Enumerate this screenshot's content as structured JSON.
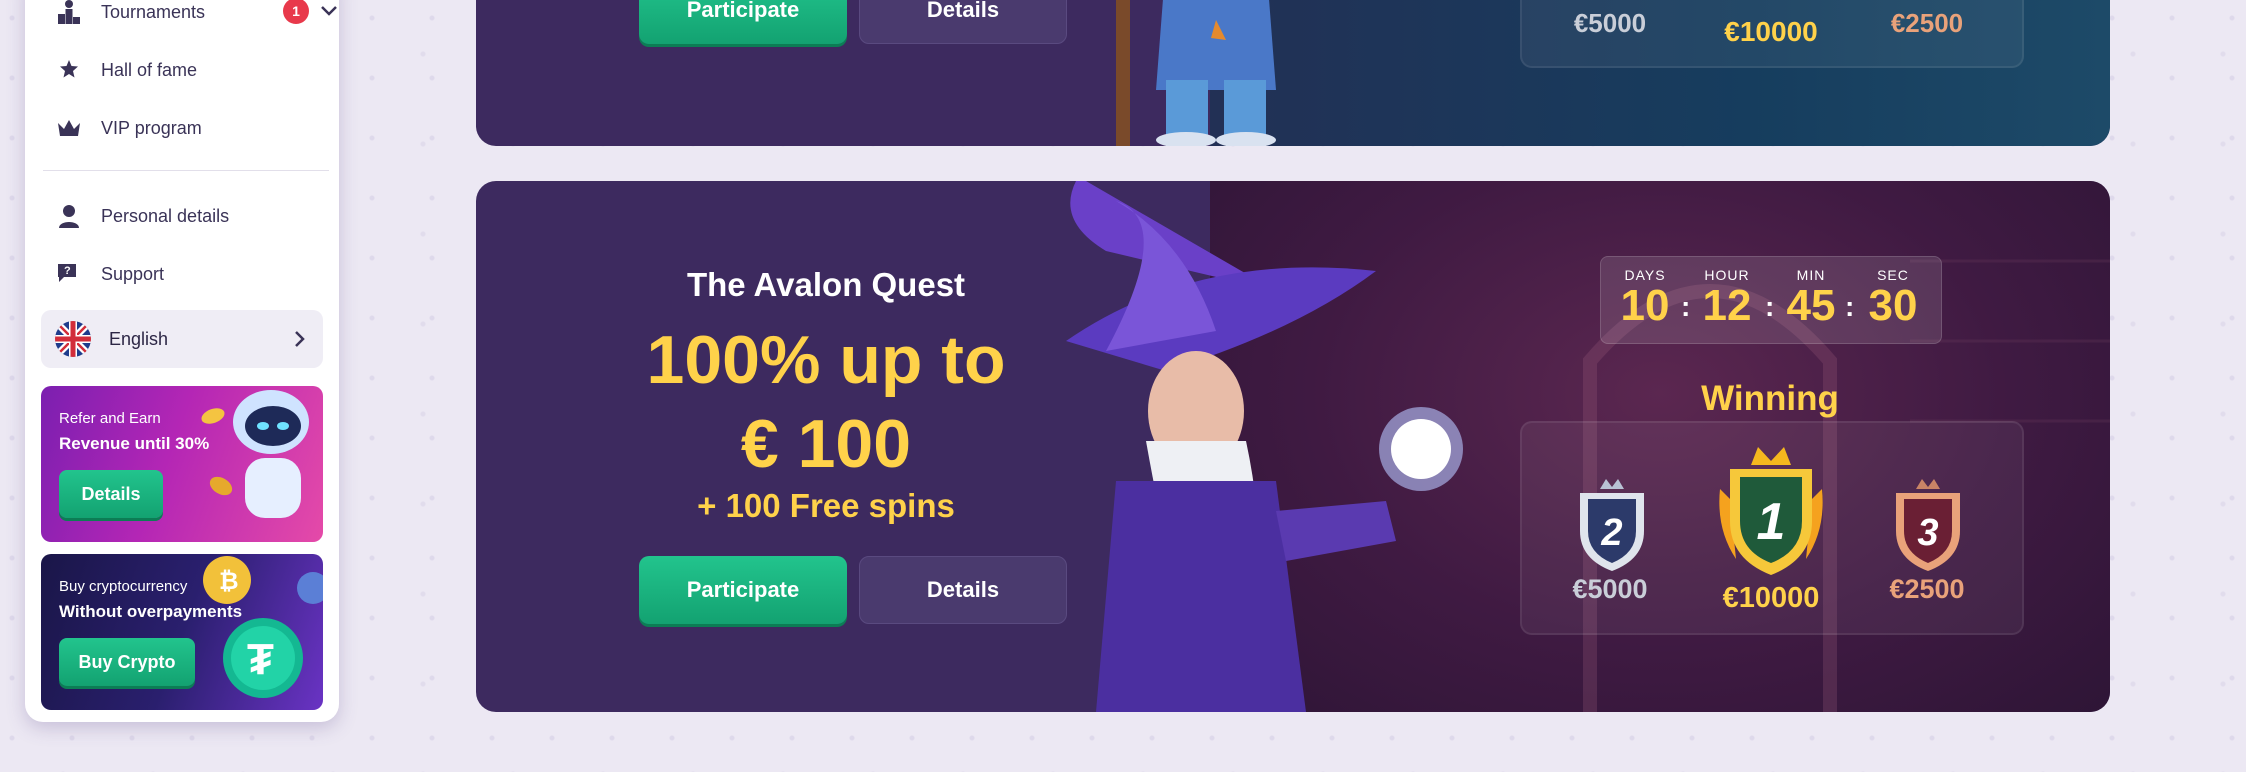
{
  "sidebar": {
    "items": [
      {
        "label": "Tournaments",
        "badge": "1"
      },
      {
        "label": "Hall of fame"
      },
      {
        "label": "VIP program"
      },
      {
        "label": "Personal details"
      },
      {
        "label": "Support"
      }
    ],
    "language": "English",
    "promos": [
      {
        "line1": "Refer and Earn",
        "line2": "Revenue until 30%",
        "button": "Details"
      },
      {
        "line1": "Buy cryptocurrency",
        "line2": "Without overpayments",
        "button": "Buy Crypto"
      }
    ]
  },
  "card_top": {
    "participate": "Participate",
    "details": "Details",
    "prizes": [
      "€5000",
      "€10000",
      "€2500"
    ]
  },
  "card_main": {
    "title": "The Avalon Quest",
    "bonus_line1": "100% up to",
    "bonus_line2": "€ 100",
    "spins": "+ 100 Free spins",
    "participate": "Participate",
    "details": "Details",
    "countdown": {
      "days_label": "DAYS",
      "days": "10",
      "hour_label": "HOUR",
      "hour": "12",
      "min_label": "MIN",
      "min": "45",
      "sec_label": "SEC",
      "sec": "30"
    },
    "winning_label": "Winning",
    "places": [
      {
        "rank": "2",
        "amount": "€5000"
      },
      {
        "rank": "1",
        "amount": "€10000"
      },
      {
        "rank": "3",
        "amount": "€2500"
      }
    ]
  },
  "colors": {
    "accent_green": "#1cb682",
    "gold": "#ffd24a",
    "silver": "#c9ced8",
    "bronze": "#e9a27a",
    "card_bg": "#3d2a5f"
  }
}
